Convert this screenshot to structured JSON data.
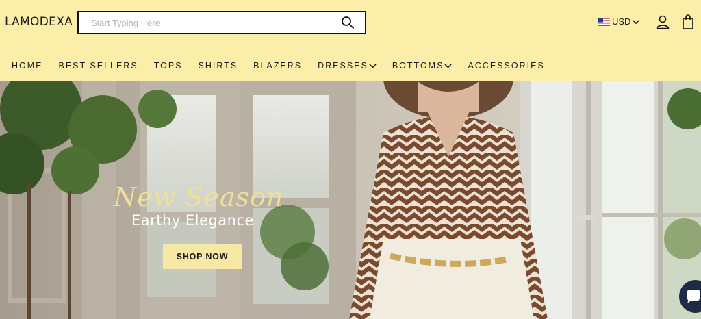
{
  "header": {
    "brand": "LAMODEXA",
    "search": {
      "placeholder": "Start Typing Here",
      "value": ""
    },
    "currency": {
      "selected": "USD",
      "flag_icon": "us-flag-icon"
    },
    "icons": [
      "search-icon",
      "user-icon",
      "shopping-bag-icon",
      "chevron-down-icon"
    ]
  },
  "nav": {
    "items": [
      {
        "label": "HOME",
        "dropdown": false
      },
      {
        "label": "BEST SELLERS",
        "dropdown": false
      },
      {
        "label": "TOPS",
        "dropdown": false
      },
      {
        "label": "SHIRTS",
        "dropdown": false
      },
      {
        "label": "BLAZERS",
        "dropdown": false
      },
      {
        "label": "DRESSES",
        "dropdown": true
      },
      {
        "label": "BOTTOMS",
        "dropdown": true
      },
      {
        "label": "ACCESSORIES",
        "dropdown": false
      }
    ]
  },
  "hero": {
    "script_title": "New Season",
    "tagline": "Earthy Elegance",
    "cta_label": "SHOP NOW"
  },
  "colors": {
    "header_bg": "#fbeea8",
    "cta_bg": "#f7e8a6",
    "script_gold": "#f2df97",
    "chat_bubble": "#1f2a44"
  }
}
